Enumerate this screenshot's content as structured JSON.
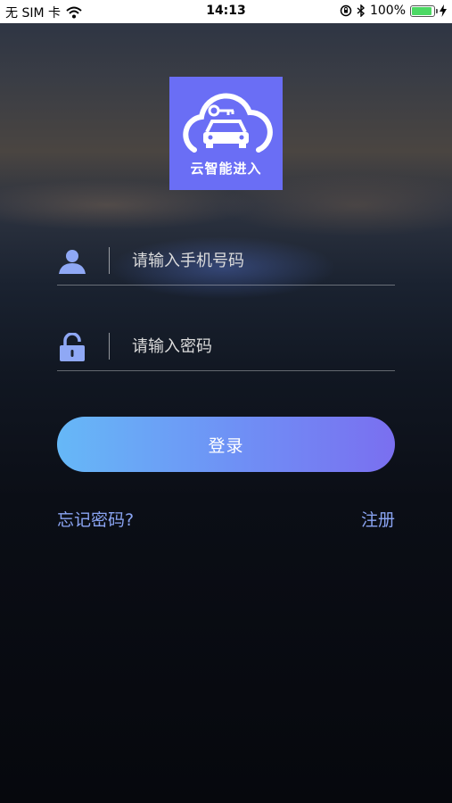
{
  "status_bar": {
    "carrier": "无 SIM 卡",
    "time": "14:13",
    "battery": "100%",
    "icons": [
      "wifi-icon",
      "orientation-lock-icon",
      "bluetooth-icon",
      "battery-icon",
      "charging-icon"
    ]
  },
  "logo": {
    "text": "云智能进入",
    "background": "#6a6ef5",
    "icons": [
      "cloud-icon",
      "car-icon",
      "key-icon"
    ]
  },
  "form": {
    "phone": {
      "placeholder": "请输入手机号码",
      "value": "",
      "icon": "user-icon"
    },
    "password": {
      "placeholder": "请输入密码",
      "value": "",
      "icon": "lock-icon"
    }
  },
  "login_button": {
    "label": "登录"
  },
  "links": {
    "forgot_password": "忘记密码?",
    "register": "注册"
  },
  "colors": {
    "accent": "#6a6ef5",
    "link": "#8aa4f2",
    "icon": "#8fa8f5"
  }
}
